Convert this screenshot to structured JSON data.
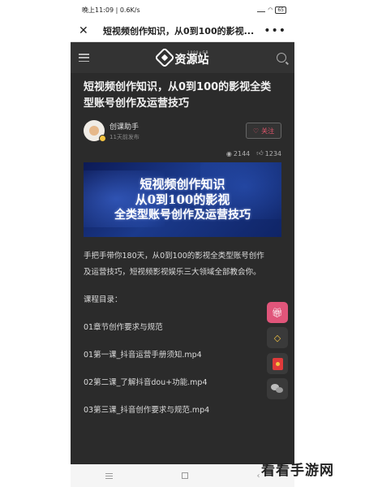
{
  "status_bar": {
    "time": "晚上11:09 | 0.6K/s",
    "battery": "65"
  },
  "title_bar": {
    "title": "短视频创作知识，从0到100的影视..."
  },
  "site_header": {
    "logo_small": "1000+GB",
    "logo_text": "资源站"
  },
  "article": {
    "title": "短视频创作知识，从0到100的影视全类型账号创作及运营技巧",
    "author": {
      "name": "创课助手",
      "time": "11天前发布"
    },
    "follow_label": "关注",
    "views": "2144",
    "likes": "1234",
    "banner_lines": [
      "短视频创作知识",
      "从0到100的影视",
      "全类型账号创作及运营技巧"
    ],
    "intro": "手把手带你180天，从0到100的影视全类型账号创作及运营技巧，短视频影视娱乐三大领域全部教会你。",
    "catalog_heading": "课程目录：",
    "catalog_items": [
      "01章节创作要求与规范",
      "01第一课_抖音运营手册须知.mp4",
      "02第二课_了解抖音dou+功能.mp4",
      "03第三课_抖音创作要求与规范.mp4"
    ]
  },
  "icons": {
    "gift": "gift-icon",
    "diamond": "diamond-icon",
    "hongbao": "red-envelope-icon",
    "wechat": "wechat-icon"
  },
  "colors": {
    "accent": "#e0557a",
    "page_bg": "#2b2b2b",
    "banner": "#1b3a8c"
  },
  "watermark": "看看手游网"
}
